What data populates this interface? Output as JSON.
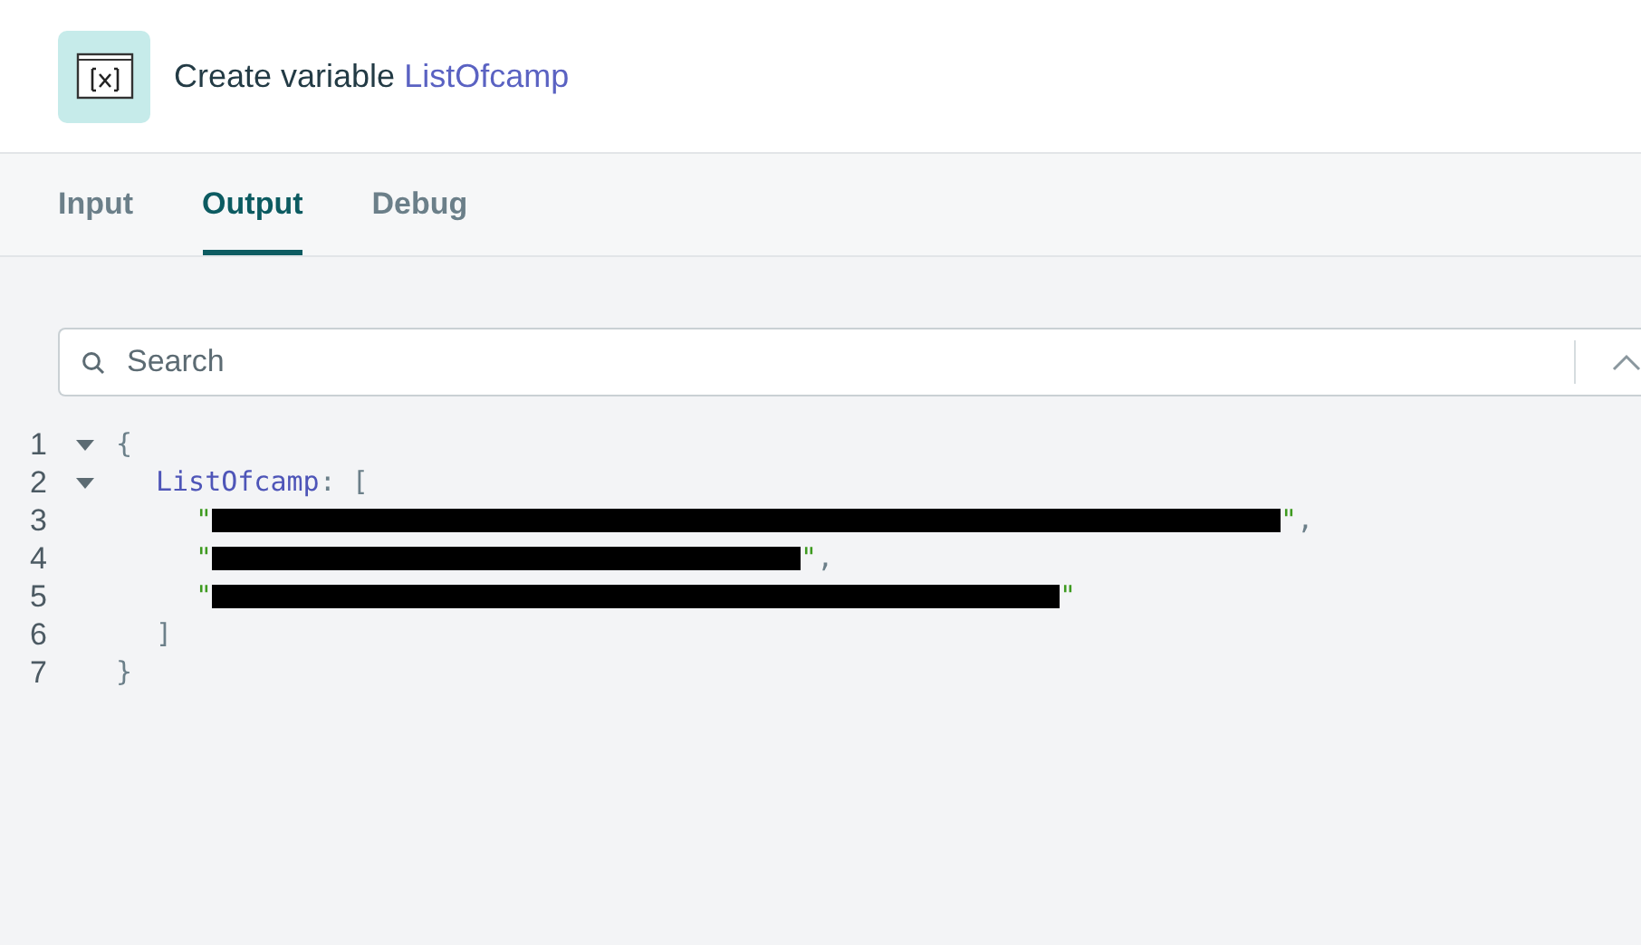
{
  "header": {
    "title": "Create variable",
    "variable": "ListOfcamp"
  },
  "tabs": [
    {
      "label": "Input",
      "selected": false
    },
    {
      "label": "Output",
      "selected": true
    },
    {
      "label": "Debug",
      "selected": false
    }
  ],
  "search": {
    "placeholder": "Search"
  },
  "code": [
    {
      "number": "1",
      "expanded": true,
      "parts": [
        {
          "kind": "punct",
          "text": "{"
        }
      ],
      "children": [
        {
          "number": "2",
          "expanded": true,
          "parts": [
            {
              "kind": "key",
              "text": "ListOfcamp"
            },
            {
              "kind": "punct",
              "text": ": ["
            }
          ],
          "children": [
            {
              "number": "3",
              "parts": [
                {
                  "kind": "string",
                  "text": "\""
                },
                {
                  "kind": "redacted"
                },
                {
                  "kind": "string",
                  "text": "\""
                },
                {
                  "kind": "punct",
                  "text": ","
                }
              ]
            },
            {
              "number": "4",
              "parts": [
                {
                  "kind": "string",
                  "text": "\""
                },
                {
                  "kind": "redacted"
                },
                {
                  "kind": "string",
                  "text": "\""
                },
                {
                  "kind": "punct",
                  "text": ","
                }
              ]
            },
            {
              "number": "5",
              "parts": [
                {
                  "kind": "string",
                  "text": "\""
                },
                {
                  "kind": "redacted"
                },
                {
                  "kind": "string",
                  "text": "\""
                }
              ]
            }
          ]
        },
        {
          "number": "6",
          "parts": [
            {
              "kind": "punct",
              "text": "]"
            }
          ]
        }
      ]
    },
    {
      "number": "7",
      "parts": [
        {
          "kind": "punct",
          "text": "}"
        }
      ]
    }
  ]
}
